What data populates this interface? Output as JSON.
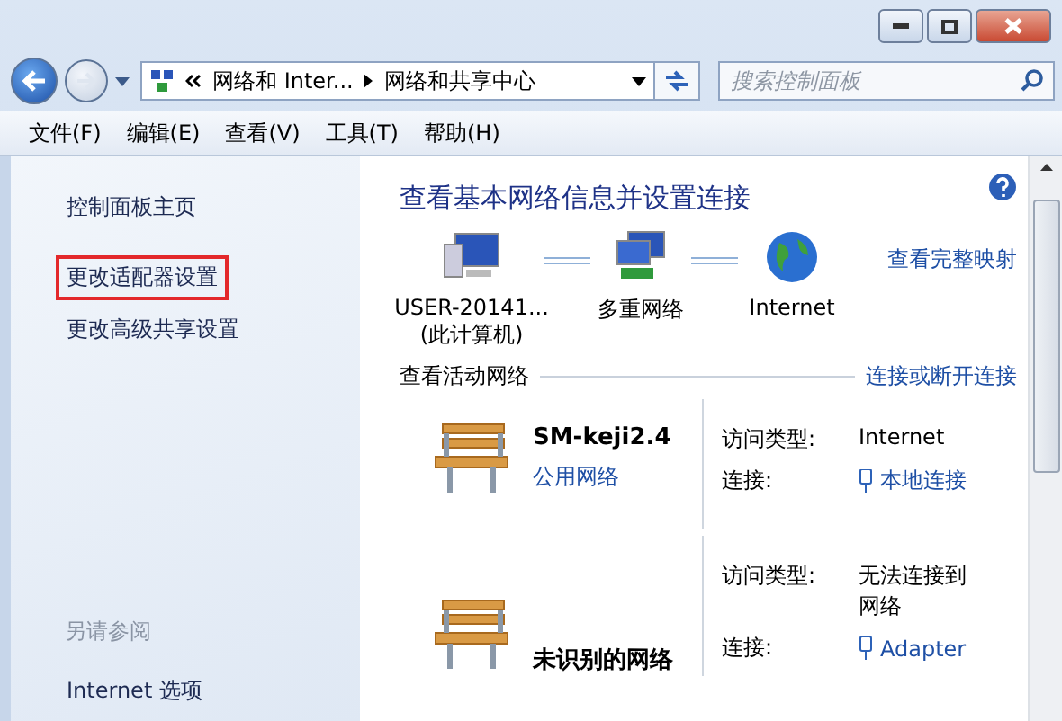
{
  "address": {
    "segments": [
      "网络和 Inter...",
      "网络和共享中心"
    ]
  },
  "search": {
    "placeholder": "搜索控制面板"
  },
  "menu": [
    "文件(F)",
    "编辑(E)",
    "查看(V)",
    "工具(T)",
    "帮助(H)"
  ],
  "sidebar": {
    "items": [
      {
        "label": "控制面板主页",
        "highlighted": false
      },
      {
        "label": "更改适配器设置",
        "highlighted": true
      },
      {
        "label": "更改高级共享设置",
        "highlighted": false
      }
    ],
    "see_also": {
      "title": "另请参阅",
      "items": [
        "Internet 选项"
      ]
    }
  },
  "main": {
    "heading": "查看基本网络信息并设置连接",
    "full_map_link": "查看完整映射",
    "map": [
      {
        "kind": "computer",
        "label": "USER-20141...",
        "sublabel": "(此计算机)"
      },
      {
        "kind": "network",
        "label": "多重网络"
      },
      {
        "kind": "globe",
        "label": "Internet"
      }
    ],
    "active_title": "查看活动网络",
    "connect_link": "连接或断开连接",
    "networks": [
      {
        "name": "SM-keji2.4",
        "type": "公用网络",
        "access_label": "访问类型:",
        "access": "Internet",
        "conn_label": "连接:",
        "conn": "本地连接"
      },
      {
        "name": "未识别的网络",
        "access_label": "访问类型:",
        "access": "无法连接到网络",
        "conn_label": "连接:",
        "conn": "Adapter"
      }
    ]
  }
}
